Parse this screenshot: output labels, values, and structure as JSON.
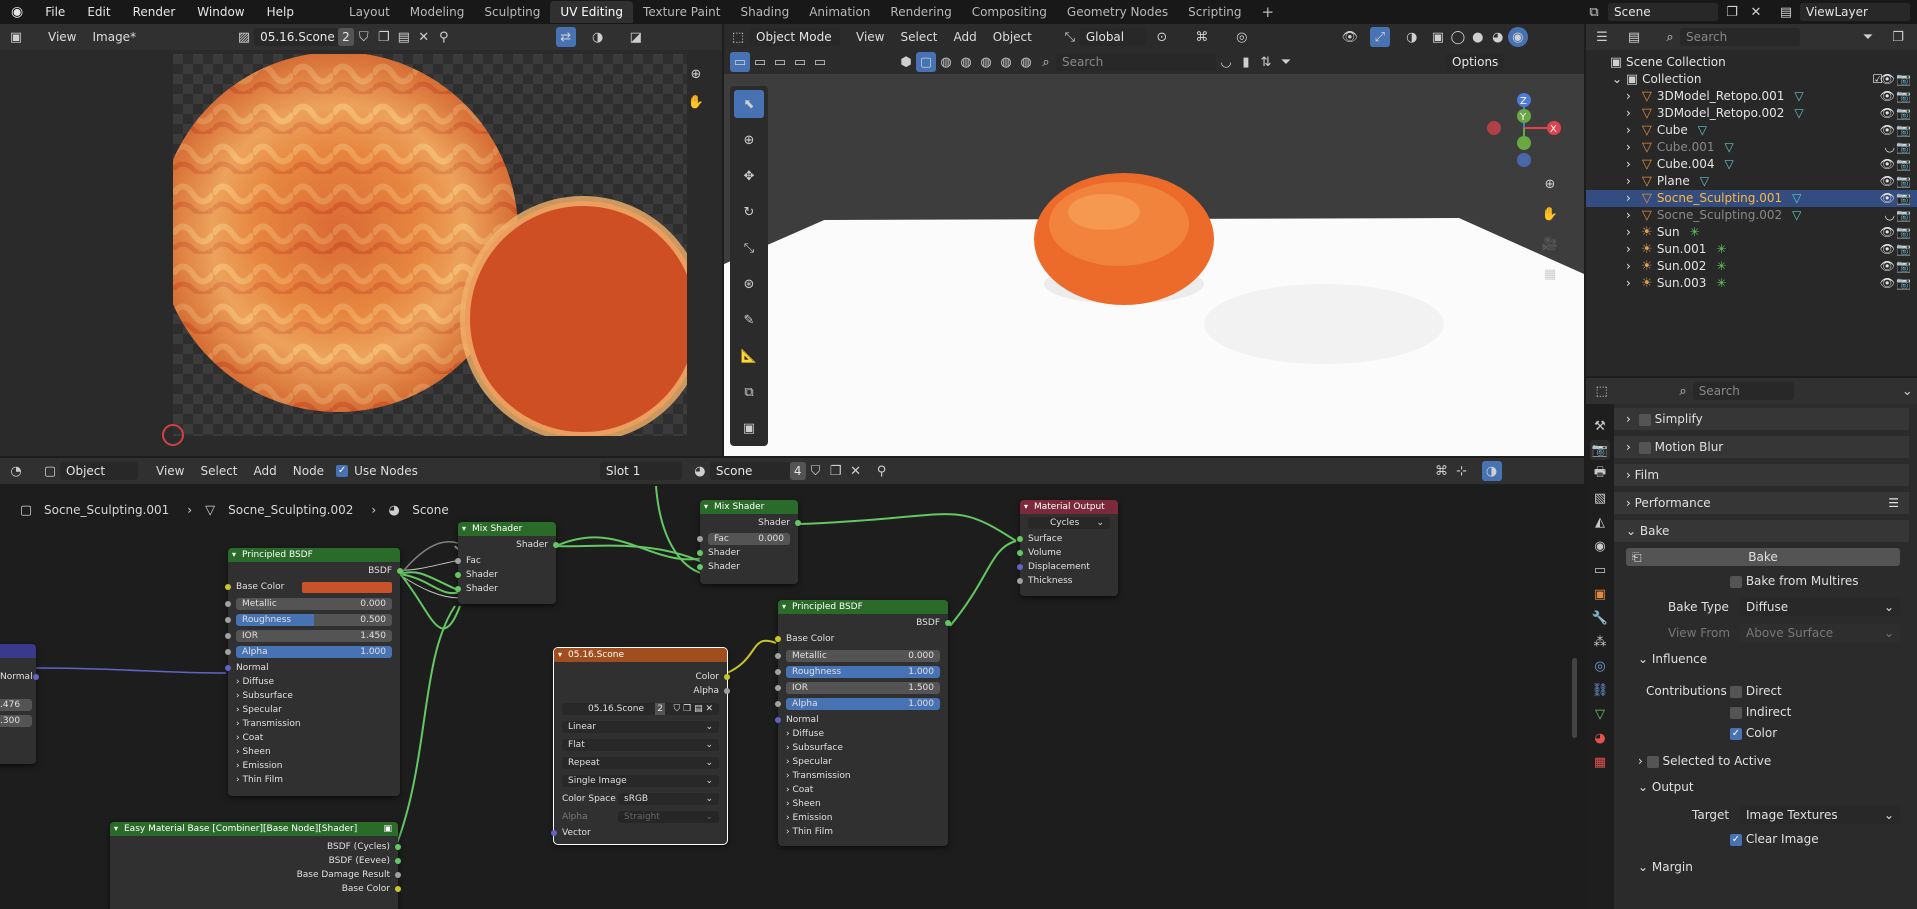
{
  "app": {
    "logo": "blender-logo-icon"
  },
  "menu": [
    "File",
    "Edit",
    "Render",
    "Window",
    "Help"
  ],
  "workspaces": [
    "Layout",
    "Modeling",
    "Sculpting",
    "UV Editing",
    "Texture Paint",
    "Shading",
    "Animation",
    "Rendering",
    "Compositing",
    "Geometry Nodes",
    "Scripting"
  ],
  "active_workspace": "UV Editing",
  "scene_name": "Scene",
  "view_layer": "ViewLayer",
  "image_editor": {
    "view": "View",
    "image_menu": "Image*",
    "image_name": "05.16.Scone",
    "users": "2"
  },
  "viewport": {
    "mode": "Object Mode",
    "menus": [
      "View",
      "Select",
      "Add",
      "Object"
    ],
    "transform": "Global",
    "search_placeholder": "Search",
    "options": "Options"
  },
  "node_editor": {
    "type": "Object",
    "menus": [
      "View",
      "Select",
      "Add",
      "Node"
    ],
    "use_nodes_label": "Use Nodes",
    "slot": "Slot 1",
    "material": "Scone",
    "material_users": "4",
    "breadcrumb": [
      "Socne_Sculpting.001",
      "Socne_Sculpting.002",
      "Scone"
    ]
  },
  "nodes": {
    "mix1": {
      "title": "Mix Shader",
      "out": "Shader",
      "inputs": [
        "Fac",
        "Shader",
        "Shader"
      ]
    },
    "mix2": {
      "title": "Mix Shader",
      "out": "Shader",
      "fac_label": "Fac",
      "fac": "0.000",
      "inputs": [
        "Shader",
        "Shader"
      ]
    },
    "output": {
      "title": "Material Output",
      "target": "Cycles",
      "inputs": [
        "Surface",
        "Volume",
        "Displacement",
        "Thickness"
      ]
    },
    "bsdf1": {
      "title": "Principled BSDF",
      "out": "BSDF",
      "base_color": "Base Color",
      "metallic": "Metallic",
      "metallic_v": "0.000",
      "roughness": "Roughness",
      "roughness_v": "0.500",
      "ior": "IOR",
      "ior_v": "1.450",
      "alpha": "Alpha",
      "alpha_v": "1.000",
      "normal": "Normal",
      "panels": [
        "Diffuse",
        "Subsurface",
        "Specular",
        "Transmission",
        "Coat",
        "Sheen",
        "Emission",
        "Thin Film"
      ]
    },
    "bsdf2": {
      "title": "Principled BSDF",
      "out": "BSDF",
      "base_color": "Base Color",
      "metallic": "Metallic",
      "metallic_v": "0.000",
      "roughness": "Roughness",
      "roughness_v": "1.000",
      "ior": "IOR",
      "ior_v": "1.500",
      "alpha": "Alpha",
      "alpha_v": "1.000",
      "normal": "Normal",
      "panels": [
        "Diffuse",
        "Subsurface",
        "Specular",
        "Transmission",
        "Coat",
        "Sheen",
        "Emission",
        "Thin Film"
      ]
    },
    "image": {
      "title": "05.16.Scone",
      "outs": [
        "Color",
        "Alpha"
      ],
      "image": "05.16.Scone",
      "users": "2",
      "interp": "Linear",
      "proj": "Flat",
      "ext": "Repeat",
      "source": "Single Image",
      "cs_label": "Color Space",
      "cs": "sRGB",
      "alpha_label": "Alpha",
      "alpha": "Straight",
      "vector": "Vector"
    },
    "easy": {
      "title": "Easy Material Base [Combiner][Base Node][Shader]",
      "outs": [
        "BSDF (Cycles)",
        "BSDF (Eevee)",
        "Base Damage Result",
        "Base Color"
      ]
    },
    "left": {
      "normal": "Normal",
      "v1": ".476",
      "v2": ".300"
    }
  },
  "outliner": {
    "search_placeholder": "Search",
    "root": "Scene Collection",
    "collection": "Collection",
    "items": [
      {
        "name": "3DModel_Retopo.001",
        "dim": false,
        "sel": false
      },
      {
        "name": "3DModel_Retopo.002",
        "dim": false,
        "sel": false
      },
      {
        "name": "Cube",
        "dim": false,
        "sel": false
      },
      {
        "name": "Cube.001",
        "dim": true,
        "sel": false
      },
      {
        "name": "Cube.004",
        "dim": false,
        "sel": false
      },
      {
        "name": "Plane",
        "dim": false,
        "sel": false
      },
      {
        "name": "Socne_Sculpting.001",
        "dim": false,
        "sel": true
      },
      {
        "name": "Socne_Sculpting.002",
        "dim": true,
        "sel": false
      },
      {
        "name": "Sun",
        "dim": false,
        "sel": false
      },
      {
        "name": "Sun.001",
        "dim": false,
        "sel": false
      },
      {
        "name": "Sun.002",
        "dim": false,
        "sel": false
      },
      {
        "name": "Sun.003",
        "dim": false,
        "sel": false
      }
    ]
  },
  "properties": {
    "search_placeholder": "Search",
    "simplify": "Simplify",
    "motion_blur": "Motion Blur",
    "film": "Film",
    "performance": "Performance",
    "bake": "Bake",
    "bake_button": "Bake",
    "bake_multires": "Bake from Multires",
    "bake_type_label": "Bake Type",
    "bake_type": "Diffuse",
    "view_from_label": "View From",
    "view_from": "Above Surface",
    "influence": "Influence",
    "contributions": "Contributions",
    "direct": "Direct",
    "indirect": "Indirect",
    "color": "Color",
    "selected_to_active": "Selected to Active",
    "output": "Output",
    "target_label": "Target",
    "target": "Image Textures",
    "clear_image": "Clear Image",
    "margin": "Margin"
  },
  "colors": {
    "accent": "#4772b3",
    "bsdf_header": "#2a6b2a",
    "output_header": "#7a2a3a",
    "image_header": "#a14e1e",
    "base_color_swatch": "#c9522a",
    "selected_text": "#ffb638"
  }
}
